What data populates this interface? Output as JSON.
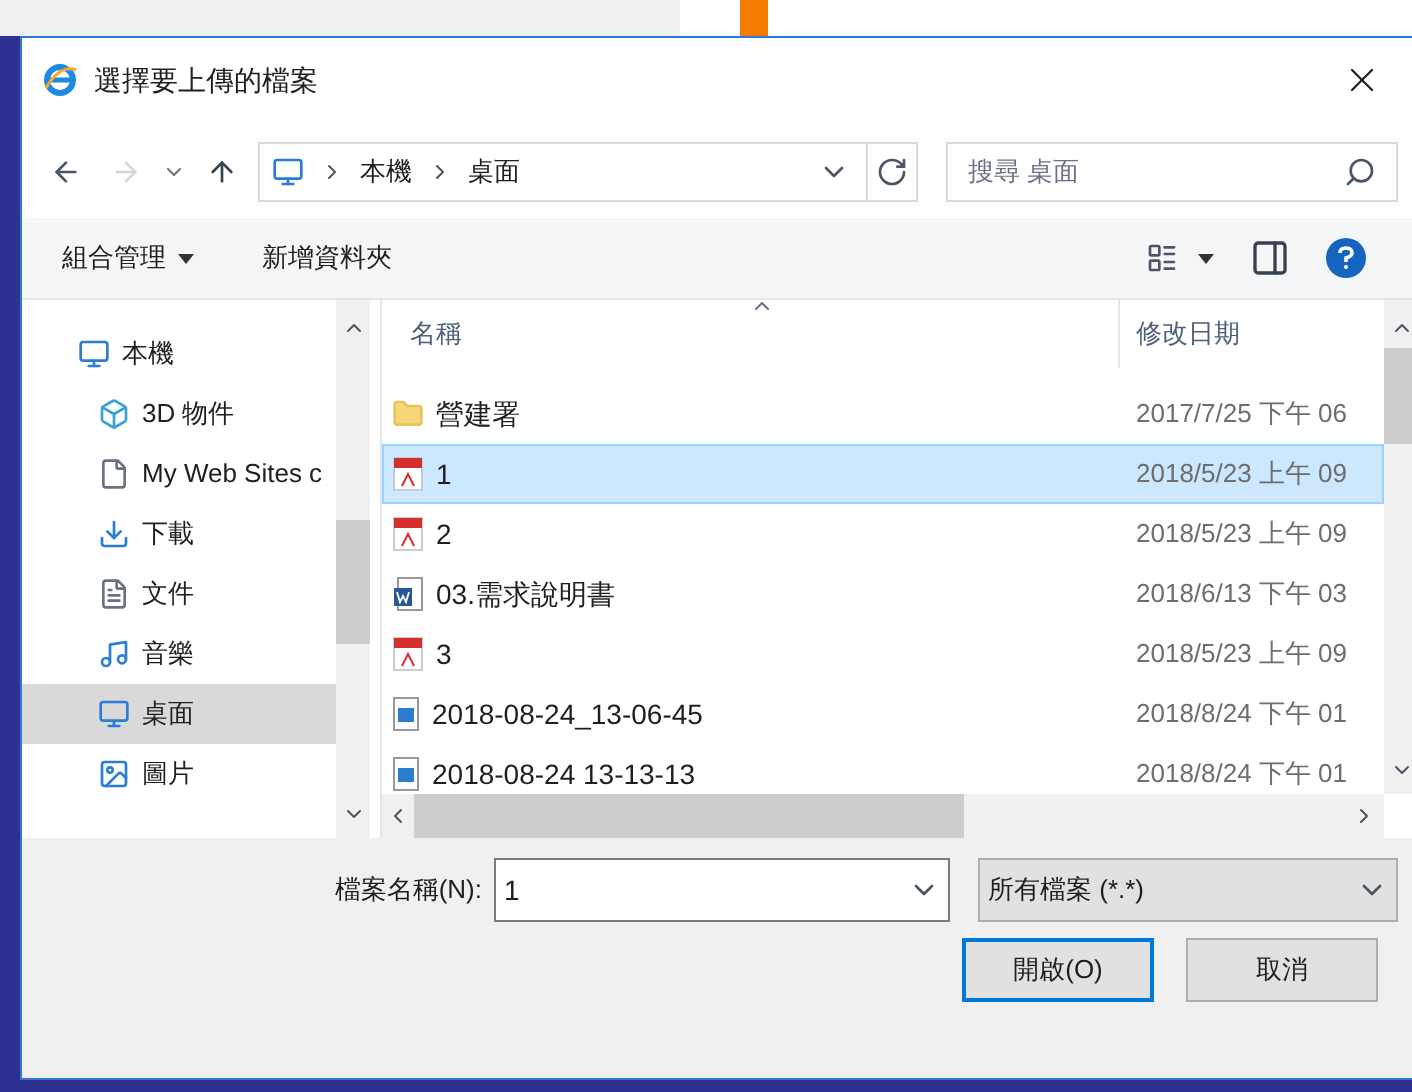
{
  "window": {
    "title": "選擇要上傳的檔案"
  },
  "address": {
    "crumbs": [
      "本機",
      "桌面"
    ],
    "search_placeholder": "搜尋 桌面"
  },
  "toolbar": {
    "organize": "組合管理",
    "new_folder": "新增資料夾"
  },
  "sidebar": {
    "items": [
      {
        "label": "本機",
        "kind": "pc",
        "selected": false
      },
      {
        "label": "3D 物件",
        "kind": "objects",
        "selected": false
      },
      {
        "label": "My Web Sites c",
        "kind": "file",
        "selected": false
      },
      {
        "label": "下載",
        "kind": "download",
        "selected": false
      },
      {
        "label": "文件",
        "kind": "docs",
        "selected": false
      },
      {
        "label": "音樂",
        "kind": "music",
        "selected": false
      },
      {
        "label": "桌面",
        "kind": "desktop",
        "selected": true
      },
      {
        "label": "圖片",
        "kind": "pictures",
        "selected": false
      }
    ]
  },
  "table": {
    "columns": [
      "名稱",
      "修改日期"
    ],
    "rows": [
      {
        "name": "營建署",
        "date": "2017/7/25 下午 06",
        "kind": "folder",
        "selected": false
      },
      {
        "name": "1",
        "date": "2018/5/23 上午 09",
        "kind": "pdf",
        "selected": true
      },
      {
        "name": "2",
        "date": "2018/5/23 上午 09",
        "kind": "pdf",
        "selected": false
      },
      {
        "name": "03.需求說明書",
        "date": "2018/6/13 下午 03",
        "kind": "word",
        "selected": false
      },
      {
        "name": "3",
        "date": "2018/5/23 上午 09",
        "kind": "pdf",
        "selected": false
      },
      {
        "name": "2018-08-24_13-06-45",
        "date": "2018/8/24 下午 01",
        "kind": "image",
        "selected": false
      },
      {
        "name": "2018-08-24 13-13-13",
        "date": "2018/8/24 下午 01",
        "kind": "image",
        "selected": false
      }
    ]
  },
  "footer": {
    "filename_label": "檔案名稱(N):",
    "filename_value": "1",
    "filter": "所有檔案 (*.*)",
    "open": "開啟(O)",
    "cancel": "取消"
  }
}
